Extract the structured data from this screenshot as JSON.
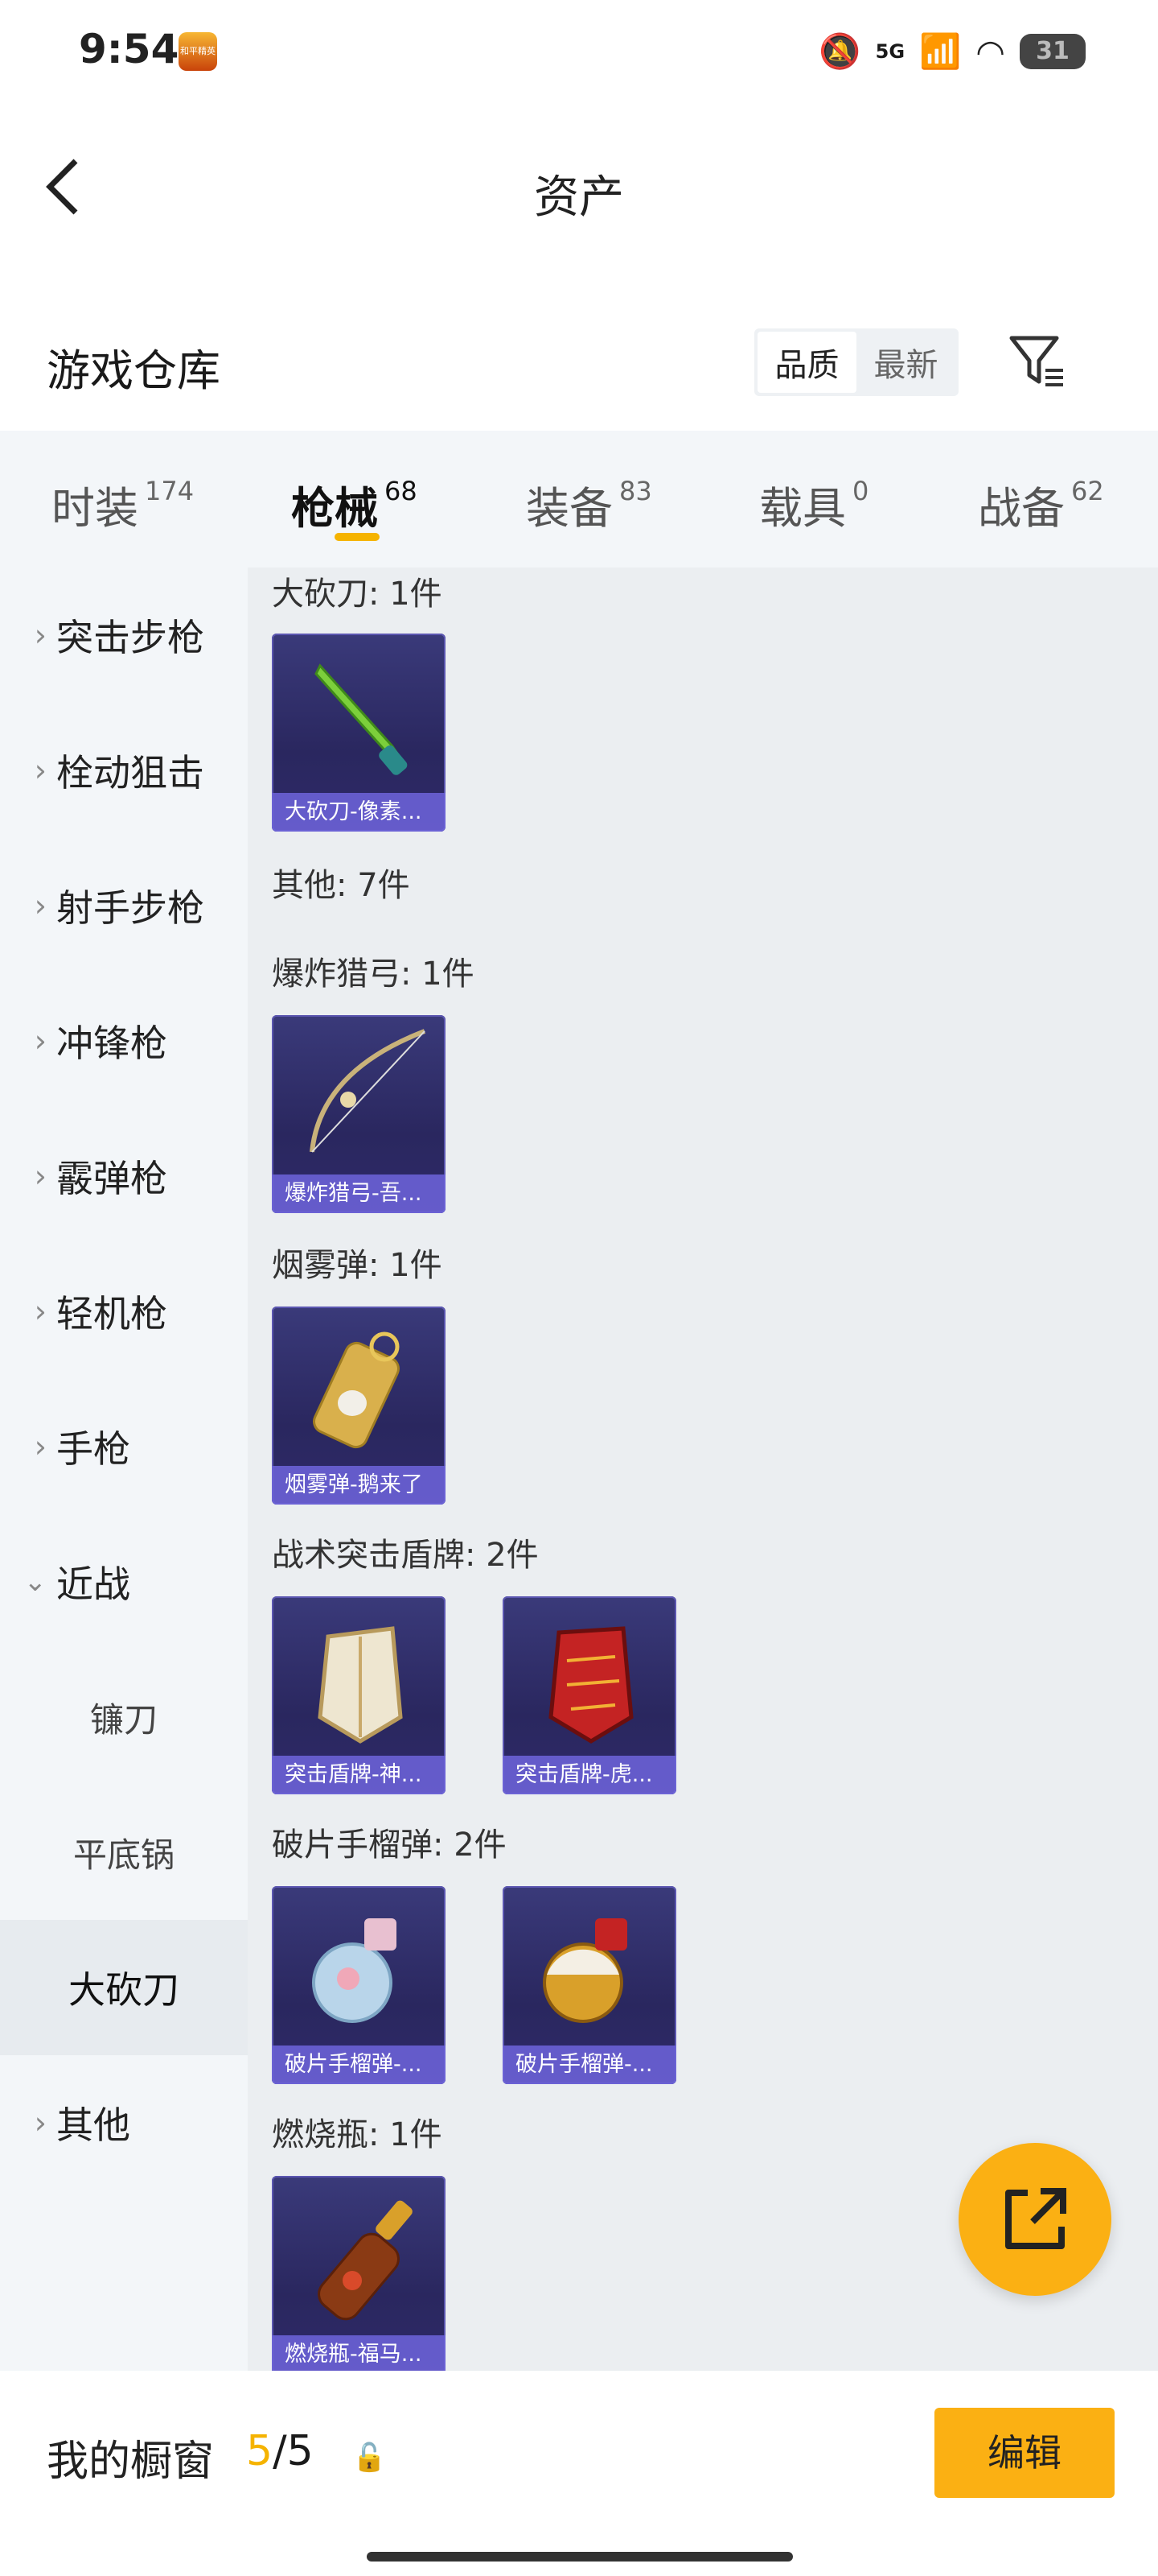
{
  "status_bar": {
    "time": "9:54",
    "app_badge": "和平精英",
    "network": "5G",
    "battery": "31"
  },
  "header": {
    "title": "资产"
  },
  "warehouse": {
    "title": "游戏仓库",
    "sort_options": [
      "品质",
      "最新"
    ],
    "active_sort": "品质"
  },
  "tabs": [
    {
      "label": "时装",
      "count": "174"
    },
    {
      "label": "枪械",
      "count": "68"
    },
    {
      "label": "装备",
      "count": "83"
    },
    {
      "label": "载具",
      "count": "0"
    },
    {
      "label": "战备",
      "count": "62"
    }
  ],
  "active_tab": "枪械",
  "sidebar": {
    "items": [
      "突击步枪",
      "栓动狙击",
      "射手步枪",
      "冲锋枪",
      "霰弹枪",
      "轻机枪",
      "手枪",
      "近战"
    ],
    "sub_items": [
      "镰刀",
      "平底锅",
      "大砍刀"
    ],
    "selected_sub": "大砍刀",
    "last_item": "其他"
  },
  "content": {
    "sections": [
      {
        "title": "大砍刀: 1件",
        "items": [
          "大砍刀-像素..."
        ]
      },
      {
        "title": "其他: 7件",
        "items": []
      },
      {
        "title": "爆炸猎弓: 1件",
        "items": [
          "爆炸猎弓-吾..."
        ]
      },
      {
        "title": "烟雾弹: 1件",
        "items": [
          "烟雾弹-鹅来了"
        ]
      },
      {
        "title": "战术突击盾牌: 2件",
        "items": [
          "突击盾牌-神...",
          "突击盾牌-虎..."
        ]
      },
      {
        "title": "破片手榴弹: 2件",
        "items": [
          "破片手榴弹-...",
          "破片手榴弹-..."
        ]
      },
      {
        "title": "燃烧瓶: 1件",
        "items": [
          "燃烧瓶-福马..."
        ]
      }
    ]
  },
  "bottom_bar": {
    "label": "我的橱窗",
    "current": "5",
    "total": "/5",
    "edit_label": "编辑"
  },
  "colors": {
    "accent": "#fbb013",
    "card_bg": "#2a275f",
    "card_caption": "#6e64dc"
  }
}
